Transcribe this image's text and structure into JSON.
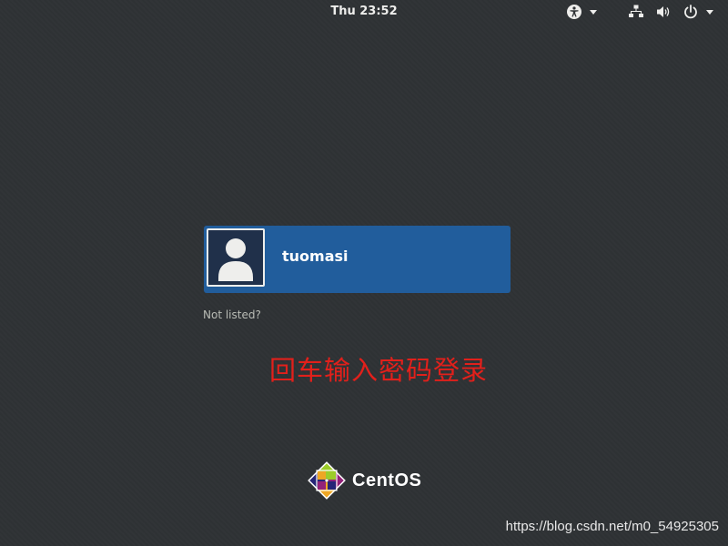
{
  "topbar": {
    "clock": "Thu 23:52",
    "accessibility_icon": "accessibility-icon",
    "network_icon": "network-wired-icon",
    "volume_icon": "volume-icon",
    "power_icon": "power-icon"
  },
  "login": {
    "username": "tuomasi",
    "not_listed": "Not listed?",
    "avatar_icon": "user-avatar-icon"
  },
  "annotation": {
    "text": "回车输入密码登录",
    "color": "#e2201b"
  },
  "branding": {
    "logo_text": "CentOS",
    "logo_icon": "centos-logo-icon"
  },
  "watermark": {
    "text": "https://blog.csdn.net/m0_54925305"
  },
  "colors": {
    "background": "#2f3235",
    "user_button": "#215d9c",
    "text": "#eeeeec"
  }
}
